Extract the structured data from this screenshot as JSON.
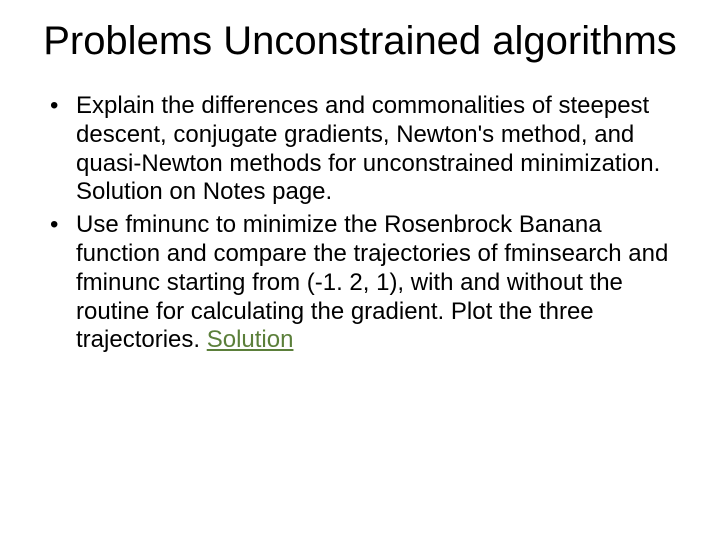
{
  "title": "Problems Unconstrained algorithms",
  "bullets": [
    {
      "text": "Explain the differences and commonalities of steepest descent, conjugate gradients, Newton's method, and quasi-Newton methods for unconstrained minimization. Solution on Notes page."
    },
    {
      "text": "Use fminunc to minimize the Rosenbrock Banana function and compare the trajectories of fminsearch and fminunc starting from (-1. 2, 1), with and without the routine for calculating the gradient. Plot the three trajectories. ",
      "link": "Solution"
    }
  ]
}
